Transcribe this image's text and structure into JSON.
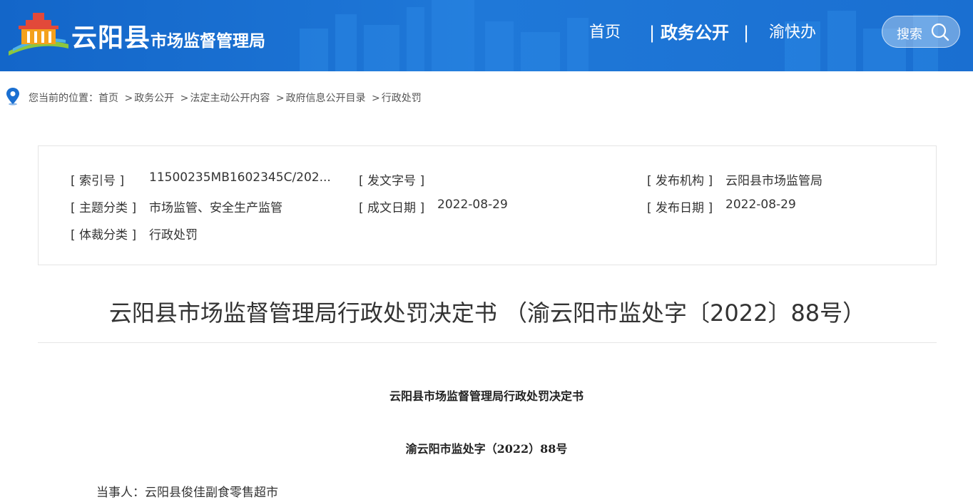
{
  "header": {
    "brand_big": "云阳县",
    "brand_small": "市场监督管理局",
    "nav": {
      "home": "首页",
      "separator": "|",
      "gov_open": "政务公开",
      "yu": "渝快办"
    },
    "search_label": "搜索",
    "colors": {
      "bar": "#1a6fd1",
      "text": "#ffffff"
    }
  },
  "breadcrumb": {
    "prefix": "您当前的位置：",
    "items": [
      "首页",
      "政务公开",
      "法定主动公开内容",
      "政府信息公开目录",
      "行政处罚"
    ],
    "separator": ">"
  },
  "info": {
    "index_no": {
      "label": "[ 索引号 ]",
      "value": "11500235MB1602345C/202..."
    },
    "doc_no": {
      "label": "[ 发文字号 ]",
      "value": ""
    },
    "publisher": {
      "label": "[ 发布机构 ]",
      "value": "云阳县市场监管局"
    },
    "topic": {
      "label": "[ 主题分类 ]",
      "value": "市场监管、安全生产监管"
    },
    "created": {
      "label": "[ 成文日期 ]",
      "value": "2022-08-29"
    },
    "published": {
      "label": "[ 发布日期 ]",
      "value": "2022-08-29"
    },
    "genre": {
      "label": "[ 体裁分类 ]",
      "value": "行政处罚"
    }
  },
  "document": {
    "title": "云阳县市场监督管理局行政处罚决定书 （渝云阳市监处字〔2022〕88号）",
    "subtitle": "云阳县市场监督管理局行政处罚决定书",
    "case_no": "渝云阳市监处字（2022）88号",
    "party": "当事人：云阳县俊佳副食零售超市"
  }
}
